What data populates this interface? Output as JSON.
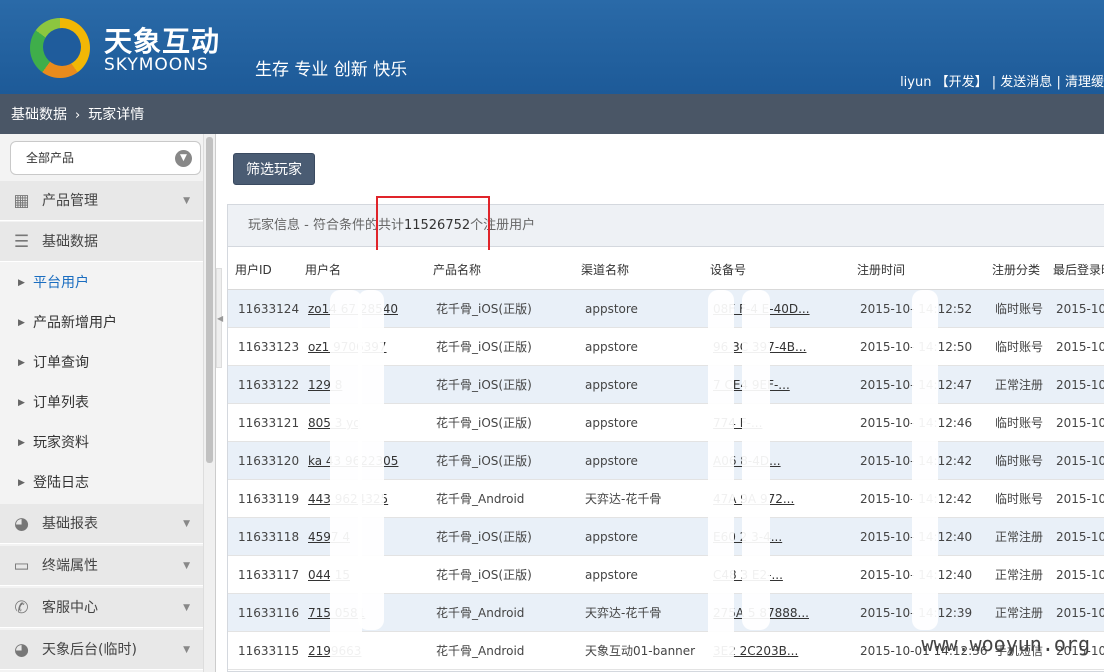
{
  "header": {
    "logo_cn": "天象互动",
    "logo_en": "SKYMOONS",
    "slogan": "生存 专业 创新 快乐",
    "user": "liyun",
    "role": "【开发】",
    "sep1": "|",
    "send_msg": "发送消息",
    "sep2": "|",
    "clear": "清理缓"
  },
  "breadcrumb": {
    "root": "基础数据",
    "sep": "›",
    "current": "玩家详情"
  },
  "sidebar": {
    "product_select": "全部产品",
    "menus": [
      {
        "label": "产品管理",
        "icon": "grid-icon"
      },
      {
        "label": "基础数据",
        "icon": "list-icon"
      },
      {
        "label": "基础报表",
        "icon": "pie-chart-icon"
      },
      {
        "label": "终端属性",
        "icon": "monitor-icon"
      },
      {
        "label": "客服中心",
        "icon": "phone-icon"
      },
      {
        "label": "天象后台(临时)",
        "icon": "pie-chart-icon"
      }
    ],
    "subitems": [
      "平台用户",
      "产品新增用户",
      "订单查询",
      "订单列表",
      "玩家资料",
      "登陆日志"
    ]
  },
  "main": {
    "filter_button": "筛选玩家",
    "panel_title_prefix": "玩家信息 - 符合条件的共计",
    "total_count": "11526752",
    "panel_title_suffix": "个注册用户"
  },
  "table": {
    "headers": [
      "用户ID",
      "用户名",
      "产品名称",
      "渠道名称",
      "设备号",
      "注册时间",
      "注册分类",
      "最后登录时"
    ],
    "rows": [
      {
        "id": "11633124",
        "user": "zo14   67    28540",
        "product": "花千骨_iOS(正版)",
        "channel": "appstore",
        "device": "08F      F-4   E-40D...",
        "time": "2015-10-     14:12:52",
        "type": "临时账号",
        "last": "2015-10"
      },
      {
        "id": "11633123",
        "user": "oz1      9706397",
        "product": "花千骨_iOS(正版)",
        "channel": "appstore",
        "device": "96     3C      397-4B...",
        "time": "2015-10-     14:12:50",
        "type": "临时账号",
        "last": "2015-10"
      },
      {
        "id": "11633122",
        "user": "129      8",
        "product": "花千骨_iOS(正版)",
        "channel": "appstore",
        "device": "7   CE4     9EF-...",
        "time": "2015-10-     14:12:47",
        "type": "正常注册",
        "last": "2015-10"
      },
      {
        "id": "11633121",
        "user": "805    3     yd",
        "product": "花千骨_iOS(正版)",
        "channel": "appstore",
        "device": "   774       F-...",
        "time": "2015-10-     14:12:46",
        "type": "临时账号",
        "last": "2015-10"
      },
      {
        "id": "11633120",
        "user": "ka      43     9622305",
        "product": "花千骨_iOS(正版)",
        "channel": "appstore",
        "device": "   A06       8-4D...",
        "time": "2015-10-     14:12:42",
        "type": "临时账号",
        "last": "2015-10"
      },
      {
        "id": "11633119",
        "user": "    443     9624325",
        "product": "花千骨_Android",
        "channel": "天弈达-花千骨",
        "device": "   47A     9A   972...",
        "time": "2015-10-     14:12:42",
        "type": "临时账号",
        "last": "2015-10"
      },
      {
        "id": "11633118",
        "user": "   4597     4",
        "product": "花千骨_iOS(正版)",
        "channel": "appstore",
        "device": "   E60      2     3-4...",
        "time": "2015-10-     14:12:40",
        "type": "正常注册",
        "last": "2015-10"
      },
      {
        "id": "11633117",
        "user": "   044       15",
        "product": "花千骨_iOS(正版)",
        "channel": "appstore",
        "device": "   C48      3     E2-...",
        "time": "2015-10-     14:12:40",
        "type": "正常注册",
        "last": "2015-10"
      },
      {
        "id": "11633116",
        "user": "   715     0581",
        "product": "花千骨_Android",
        "channel": "天弈达-花千骨",
        "device": "   275A       5   87888...",
        "time": "2015-10-     14:12:39",
        "type": "正常注册",
        "last": "2015-10"
      },
      {
        "id": "11633115",
        "user": "      2199663",
        "product": "花千骨_Android",
        "channel": "天象互动01-banner",
        "device": "   3E2        2C203B...",
        "time": "2015-10-01 14:12:36",
        "type": "手机短信",
        "last": "2015-10"
      }
    ]
  },
  "watermark": "www.wooyun.org"
}
